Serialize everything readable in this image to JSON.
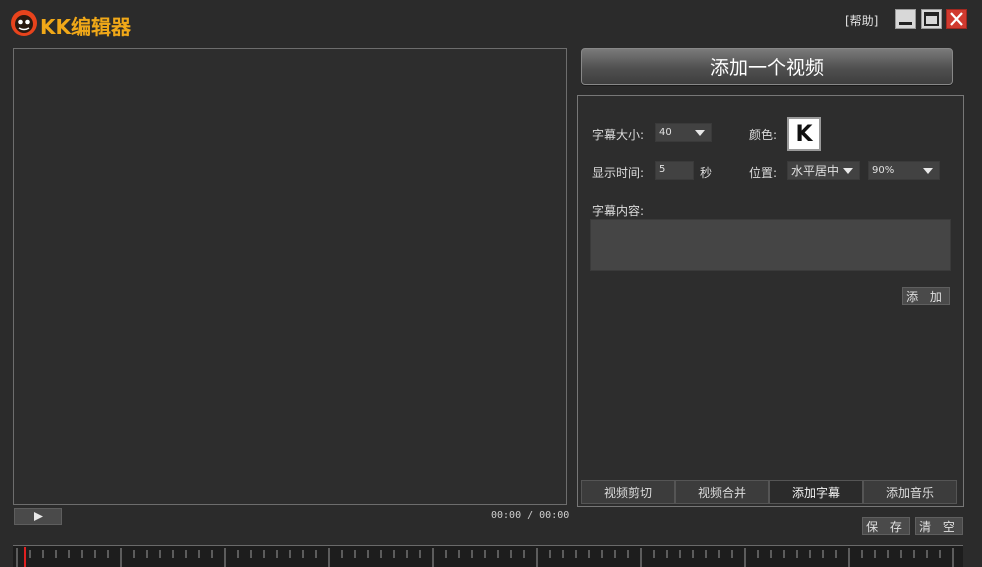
{
  "app": {
    "title": "KK编辑器",
    "help_label": "[帮助]"
  },
  "player": {
    "time": "00:00 / 00:00"
  },
  "add_video_label": "添加一个视频",
  "subtitle": {
    "size_label": "字幕大小:",
    "size_value": "40",
    "color_label": "颜色:",
    "color_sample_text": "K",
    "duration_label": "显示时间:",
    "duration_value": "5",
    "seconds_label": "秒",
    "position_label": "位置:",
    "position_value": "水平居中",
    "percent_value": "90%",
    "content_label": "字幕内容:",
    "content_value": "",
    "add_label": "添 加"
  },
  "tabs": [
    {
      "label": "视频剪切",
      "active": false
    },
    {
      "label": "视频合并",
      "active": false
    },
    {
      "label": "添加字幕",
      "active": true
    },
    {
      "label": "添加音乐",
      "active": false
    }
  ],
  "actions": {
    "save_label": "保 存",
    "clear_label": "清 空"
  },
  "colors": {
    "accent": "#f0a818",
    "close": "#d13a2f",
    "playhead": "#e02020"
  }
}
